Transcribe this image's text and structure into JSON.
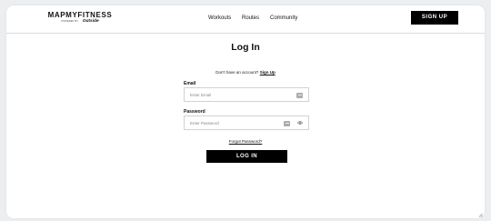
{
  "header": {
    "logo_text": "MAPMYFITNESS",
    "logo_powered_by": "POWERED BY",
    "logo_brand": "Outside",
    "nav": [
      "Workouts",
      "Routes",
      "Community"
    ],
    "signup_label": "SIGN UP"
  },
  "main": {
    "title": "Log In",
    "no_account_text": "Don't have an account?",
    "signup_link": "Sign Up",
    "email_label": "Email",
    "email_placeholder": "Enter Email",
    "email_value": "",
    "password_label": "Password",
    "password_placeholder": "Enter Password",
    "password_value": "",
    "forgot_label": "Forgot Password?",
    "login_label": "LOG IN"
  },
  "colors": {
    "primary": "#000000",
    "background": "#eceef0",
    "card": "#ffffff",
    "field_border": "#cfd3d8"
  },
  "icons": {
    "email_autofill": "key-autofill-icon",
    "password_autofill": "key-autofill-icon",
    "password_toggle": "eye-icon",
    "resize_handle": "resize-grip-icon"
  }
}
